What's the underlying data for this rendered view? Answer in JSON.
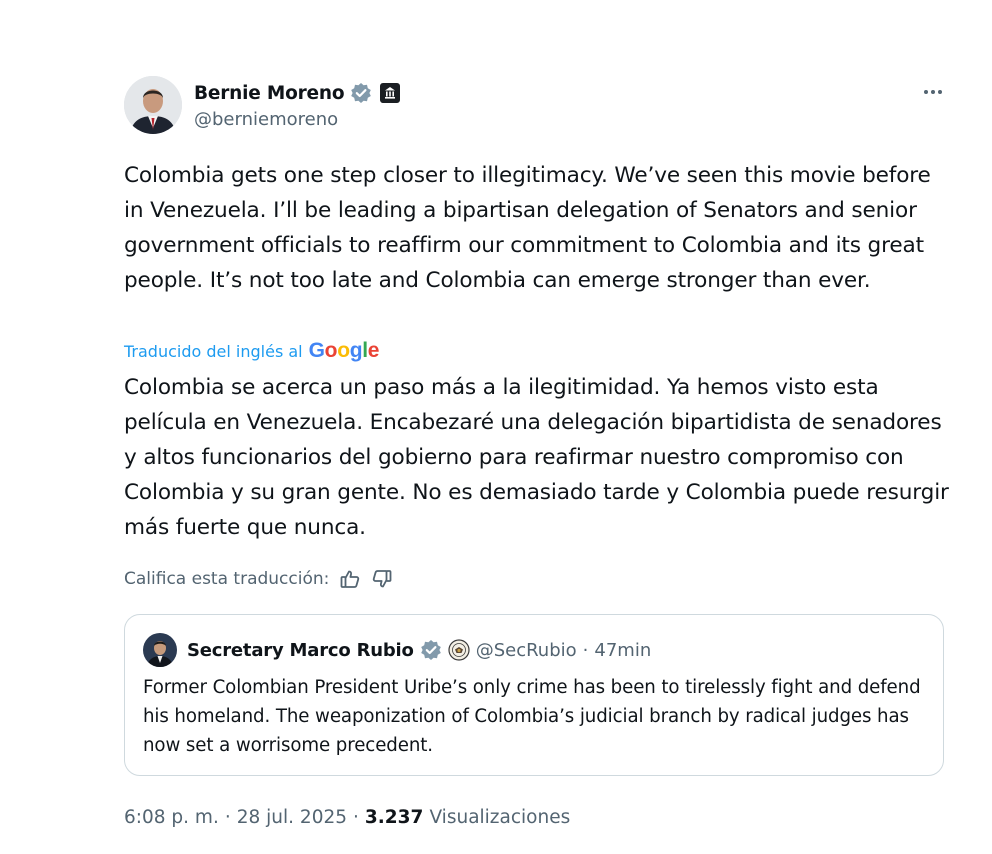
{
  "author": {
    "name": "Bernie Moreno",
    "handle": "@berniemoreno",
    "verified_color": "#829aab"
  },
  "tweet": {
    "text": "Colombia gets one step closer to illegitimacy. We’ve seen this movie before in Venezuela. I’ll be leading a bipartisan delegation of Senators and senior government officials to reaffirm our commitment to Colombia and its great people. It’s not too late and Colombia can emerge stronger than ever.",
    "translated_label": "Traducido del inglés al",
    "translation_provider": "Google",
    "translation": "Colombia se acerca un paso más a la ilegitimidad. Ya hemos visto esta película en Venezuela. Encabezaré una delegación bipartidista de senadores y altos funcionarios del gobierno para reafirmar nuestro compromiso con Colombia y su gran gente. No es demasiado tarde y Colombia puede resurgir más fuerte que nunca.",
    "rate_label": "Califica esta traducción:"
  },
  "quote": {
    "name": "Secretary Marco Rubio",
    "handle": "@SecRubio",
    "separator": "·",
    "time": "47min",
    "text": "Former Colombian President Uribe’s only crime has been to tirelessly fight and defend his homeland. The weaponization of Colombia’s judicial branch by radical judges has now set a worrisome precedent."
  },
  "meta": {
    "time": "6:08 p. m.",
    "sep1": "·",
    "date": "28 jul. 2025",
    "sep2": "·",
    "views_count": "3.237",
    "views_label": "Visualizaciones"
  },
  "icons": {
    "verified": "verified-badge-icon",
    "government": "government-building-icon",
    "more": "more-options-icon",
    "thumb_up": "thumbs-up-icon",
    "thumb_down": "thumbs-down-icon",
    "state_seal": "state-department-seal-icon"
  },
  "colors": {
    "link_blue": "#1d9bf0",
    "secondary_text": "#536471",
    "border": "#cfd9de"
  }
}
